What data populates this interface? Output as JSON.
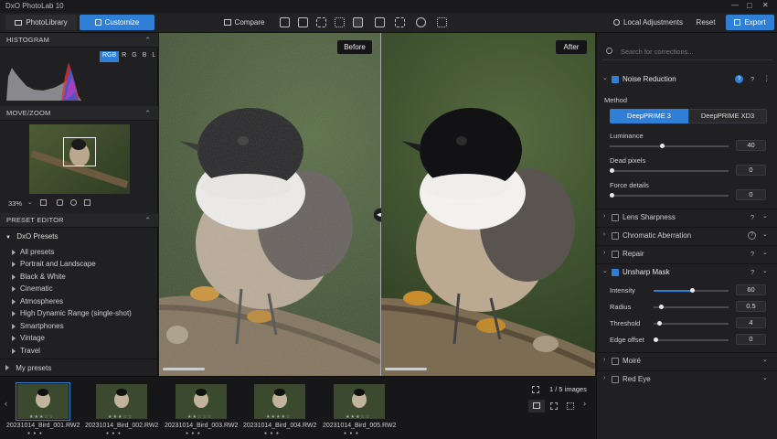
{
  "app": {
    "title": "DxO PhotoLab 10"
  },
  "window_controls": {
    "minimize": "—",
    "maximize": "□",
    "close": "✕"
  },
  "toolbar": {
    "tab_library": "PhotoLibrary",
    "tab_customize": "Customize",
    "compare": "Compare",
    "local_adjustments": "Local Adjustments",
    "reset": "Reset",
    "export": "Export"
  },
  "histogram": {
    "title": "HISTOGRAM",
    "channels": [
      "RGB",
      "R",
      "G",
      "B",
      "L"
    ]
  },
  "move_zoom": {
    "title": "MOVE/ZOOM",
    "zoom": "33%"
  },
  "preset_editor": {
    "title": "PRESET EDITOR",
    "group": "DxO Presets",
    "items": [
      "All presets",
      "Portrait and Landscape",
      "Black & White",
      "Cinematic",
      "Atmospheres",
      "High Dynamic Range (single-shot)",
      "Smartphones",
      "Vintage",
      "Travel"
    ],
    "my_presets": "My presets"
  },
  "viewer": {
    "before": "Before",
    "after": "After"
  },
  "search": {
    "placeholder": "Search for corrections..."
  },
  "noise_reduction": {
    "title": "Noise Reduction",
    "method_label": "Method",
    "methods": [
      "DeepPRIME 3",
      "DeepPRIME XD3"
    ],
    "luminance": {
      "label": "Luminance",
      "value": "40"
    },
    "dead_pixels": {
      "label": "Dead pixels",
      "value": "0"
    },
    "force_details": {
      "label": "Force details",
      "value": "0"
    }
  },
  "collapsed_panels": [
    "Lens Sharpness",
    "Chromatic Aberration",
    "Repair"
  ],
  "unsharp_mask": {
    "title": "Unsharp Mask",
    "intensity": {
      "label": "Intensity",
      "value": "60"
    },
    "radius": {
      "label": "Radius",
      "value": "0.5"
    },
    "threshold": {
      "label": "Threshold",
      "value": "4"
    },
    "edge_offset": {
      "label": "Edge offset",
      "value": "0"
    }
  },
  "bottom_panels": [
    "Moiré",
    "Red Eye"
  ],
  "filmstrip": {
    "count": "1 / 5 images",
    "items": [
      {
        "name": "20231014_Bird_001.RW2"
      },
      {
        "name": "20231014_Bird_002.RW2"
      },
      {
        "name": "20231014_Bird_003.RW2"
      },
      {
        "name": "20231014_Bird_004.RW2"
      },
      {
        "name": "20231014_Bird_005.RW2"
      }
    ]
  },
  "colors": {
    "accent": "#2f7fd6",
    "panel": "#202022",
    "background": "#1a1a1c"
  }
}
